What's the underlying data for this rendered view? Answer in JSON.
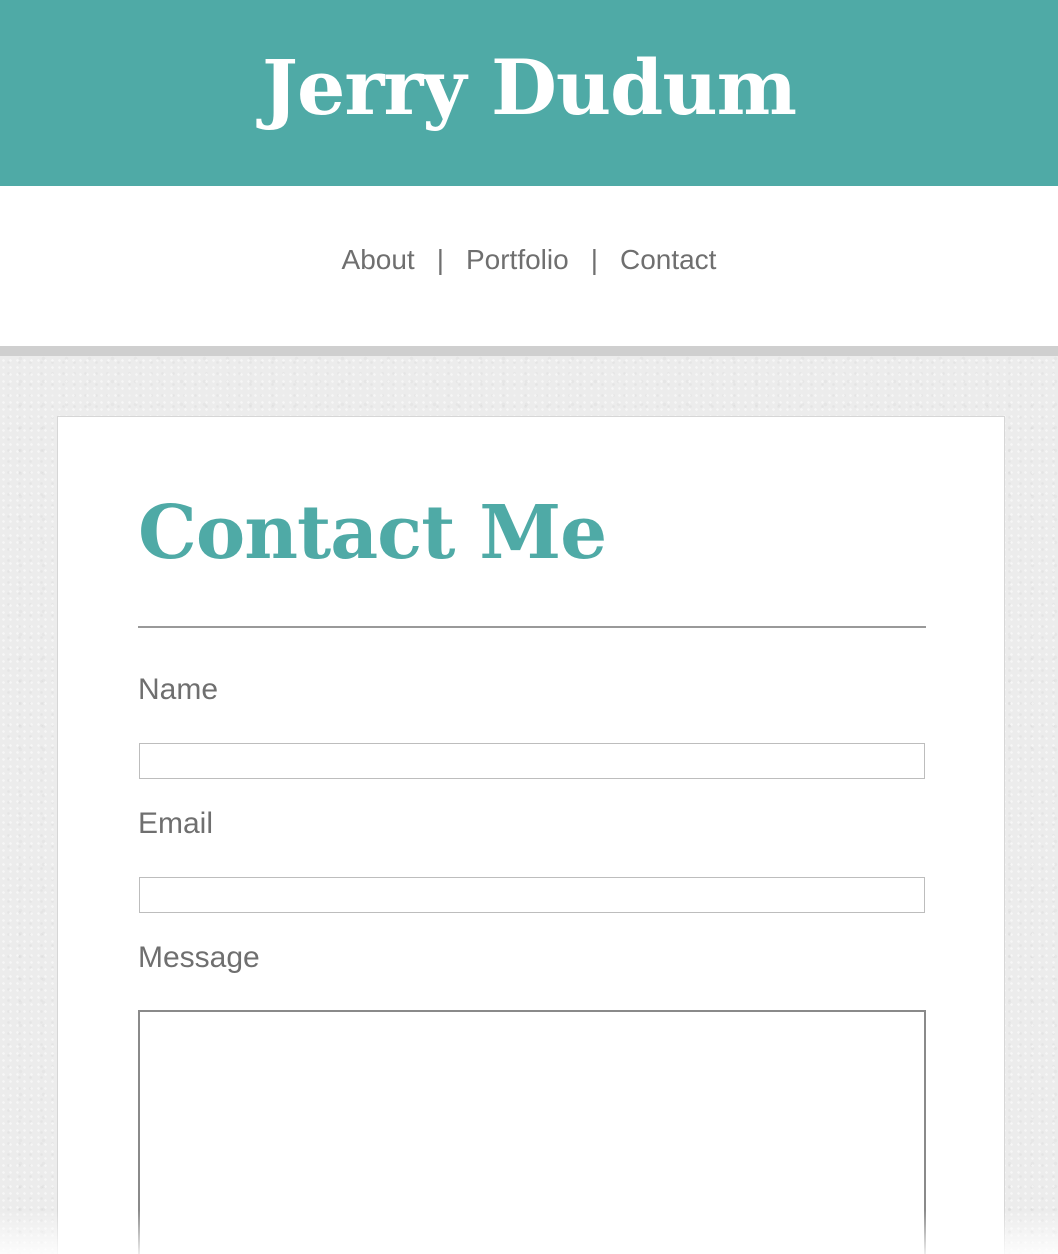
{
  "header": {
    "site_title": "Jerry Dudum"
  },
  "nav": {
    "items": [
      {
        "label": "About"
      },
      {
        "label": "Portfolio"
      },
      {
        "label": "Contact"
      }
    ],
    "separator": "|"
  },
  "contact": {
    "heading": "Contact Me",
    "fields": {
      "name": {
        "label": "Name",
        "value": ""
      },
      "email": {
        "label": "Email",
        "value": ""
      },
      "message": {
        "label": "Message",
        "value": ""
      }
    }
  },
  "colors": {
    "accent": "#4faaa6",
    "text": "#6f6f6f",
    "nav_border": "#cfcfcf"
  }
}
